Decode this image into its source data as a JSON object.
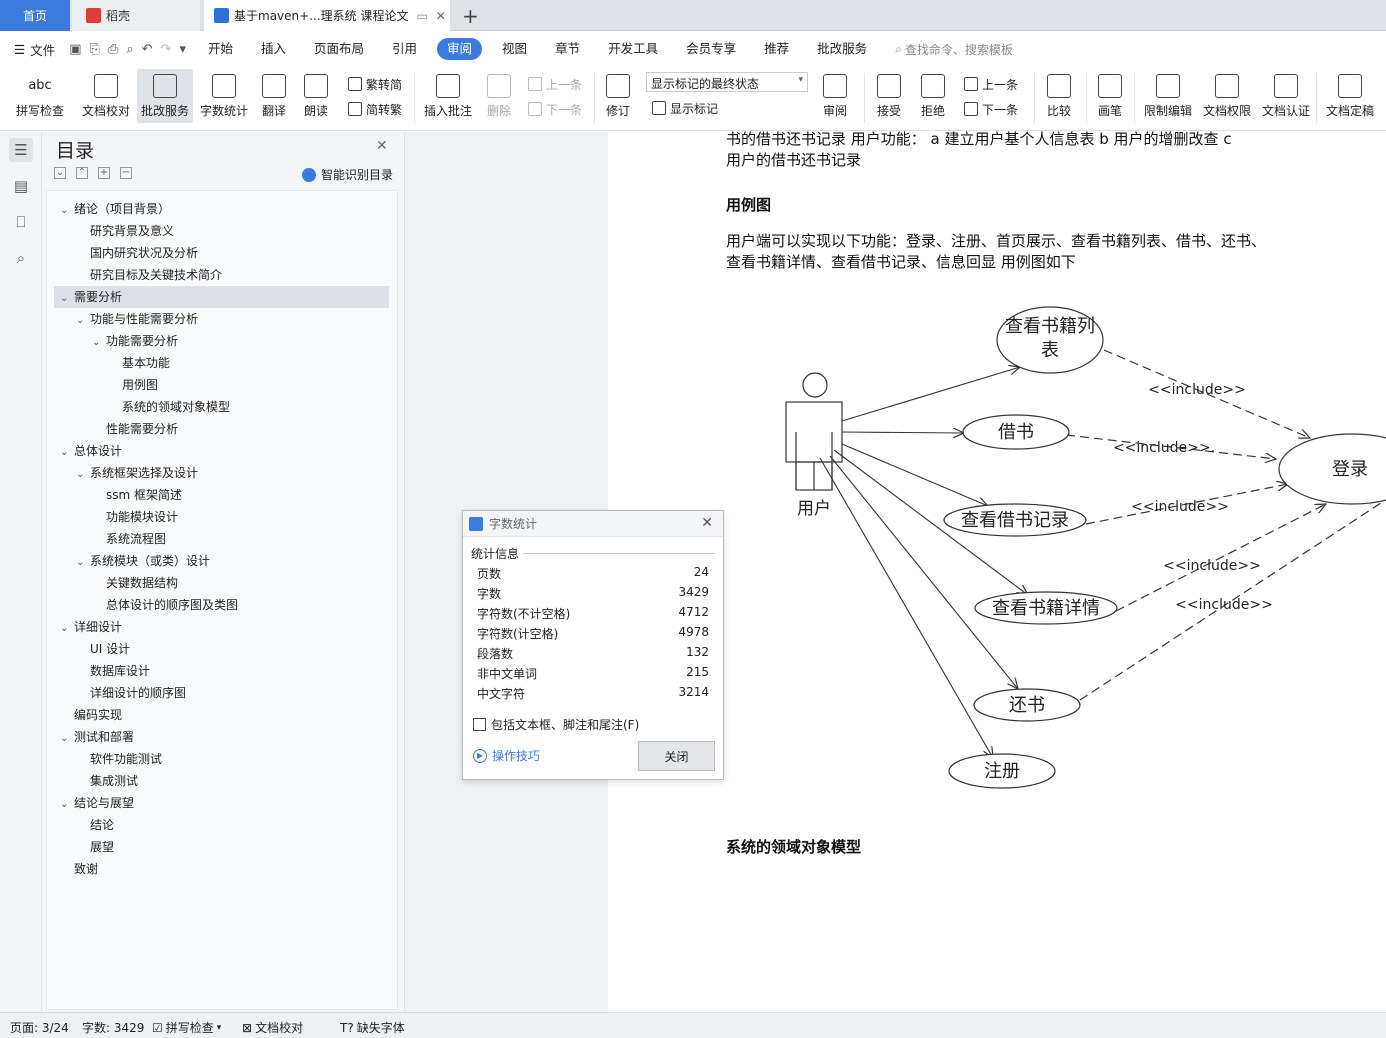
{
  "tabs": {
    "home": "首页",
    "daoke": "稻壳",
    "doc": "基于maven+...理系统 课程论文"
  },
  "menu": {
    "file": "文件",
    "items": [
      "开始",
      "插入",
      "页面布局",
      "引用",
      "审阅",
      "视图",
      "章节",
      "开发工具",
      "会员专享",
      "推荐",
      "批改服务"
    ],
    "active": "审阅",
    "search_placeholder": "查找命令、搜索模板"
  },
  "toolbar": {
    "spell": "拼写检查",
    "proof": "文档校对",
    "review_service": "批改服务",
    "word_count": "字数统计",
    "translate": "翻译",
    "read": "朗读",
    "trad": "繁转简",
    "simp": "简转繁",
    "insert_comment": "插入批注",
    "delete": "删除",
    "prev": "上一条",
    "next": "下一条",
    "revise": "修订",
    "markup_state": "显示标记的最终状态",
    "show_markup": "显示标记",
    "review": "审阅",
    "accept": "接受",
    "reject": "拒绝",
    "prev2": "上一条",
    "next2": "下一条",
    "compare": "比较",
    "pen": "画笔",
    "restrict": "限制编辑",
    "permission": "文档权限",
    "certify": "文档认证",
    "finalize": "文档定稿"
  },
  "toc": {
    "title": "目录",
    "smart": "智能识别目录",
    "items": [
      {
        "label": "绪论（项目背景）",
        "level": 0,
        "arrow": "⌄"
      },
      {
        "label": "研究背景及意义",
        "level": 1,
        "arrow": ""
      },
      {
        "label": "国内研究状况及分析",
        "level": 1,
        "arrow": ""
      },
      {
        "label": "研究目标及关键技术简介",
        "level": 1,
        "arrow": ""
      },
      {
        "label": "需要分析",
        "level": 0,
        "arrow": "⌄"
      },
      {
        "label": "功能与性能需要分析",
        "level": 1,
        "arrow": "⌄"
      },
      {
        "label": "功能需要分析",
        "level": 2,
        "arrow": "⌄"
      },
      {
        "label": "基本功能",
        "level": 3,
        "arrow": ""
      },
      {
        "label": "用例图",
        "level": 3,
        "arrow": ""
      },
      {
        "label": "系统的领域对象模型",
        "level": 3,
        "arrow": ""
      },
      {
        "label": "性能需要分析",
        "level": 2,
        "arrow": ""
      },
      {
        "label": "总体设计",
        "level": 0,
        "arrow": "⌄"
      },
      {
        "label": "系统框架选择及设计",
        "level": 1,
        "arrow": "⌄"
      },
      {
        "label": "ssm 框架简述",
        "level": 2,
        "arrow": ""
      },
      {
        "label": "功能模块设计",
        "level": 2,
        "arrow": ""
      },
      {
        "label": "系统流程图",
        "level": 2,
        "arrow": ""
      },
      {
        "label": "系统模块（或类）设计",
        "level": 1,
        "arrow": "⌄"
      },
      {
        "label": "关键数据结构",
        "level": 2,
        "arrow": ""
      },
      {
        "label": "总体设计的顺序图及类图",
        "level": 2,
        "arrow": ""
      },
      {
        "label": "详细设计",
        "level": 0,
        "arrow": "⌄"
      },
      {
        "label": "UI 设计",
        "level": 1,
        "arrow": ""
      },
      {
        "label": "数据库设计",
        "level": 1,
        "arrow": ""
      },
      {
        "label": "详细设计的顺序图",
        "level": 1,
        "arrow": ""
      },
      {
        "label": "编码实现",
        "level": 0,
        "arrow": ""
      },
      {
        "label": "测试和部署",
        "level": 0,
        "arrow": "⌄"
      },
      {
        "label": "软件功能测试",
        "level": 1,
        "arrow": ""
      },
      {
        "label": "集成测试",
        "level": 1,
        "arrow": ""
      },
      {
        "label": "结论与展望",
        "level": 0,
        "arrow": "⌄"
      },
      {
        "label": "结论",
        "level": 1,
        "arrow": ""
      },
      {
        "label": "展望",
        "level": 1,
        "arrow": ""
      },
      {
        "label": "致谢",
        "level": 0,
        "arrow": ""
      }
    ]
  },
  "doc": {
    "line1": "书的借书还书记录  用户功能：  a  建立用户基个人信息表  b  用户的增删改查  c",
    "line2": "用户的借书还书记录",
    "heading1": "用例图",
    "para1": "用户端可以实现以下功能：登录、注册、首页展示、查看书籍列表、借书、还书、",
    "para2": "查看书籍详情、查看借书记录、信息回显  用例图如下",
    "heading2": "系统的领域对象模型"
  },
  "diagram": {
    "actor": "用户",
    "uc_list_1": "查看书籍列",
    "uc_list_2": "表",
    "uc_borrow": "借书",
    "uc_records": "查看借书记录",
    "uc_detail": "查看书籍详情",
    "uc_return": "还书",
    "uc_register": "注册",
    "uc_login": "登录",
    "include": "<<include>>",
    "include_dot": "<<include>>."
  },
  "dialog": {
    "title": "字数统计",
    "section": "统计信息",
    "stats": [
      {
        "label": "页数",
        "value": "24"
      },
      {
        "label": "字数",
        "value": "3429"
      },
      {
        "label": "字符数(不计空格)",
        "value": "4712"
      },
      {
        "label": "字符数(计空格)",
        "value": "4978"
      },
      {
        "label": "段落数",
        "value": "132"
      },
      {
        "label": "非中文单词",
        "value": "215"
      },
      {
        "label": "中文字符",
        "value": "3214"
      }
    ],
    "checkbox": "包括文本框、脚注和尾注(F)",
    "tips": "操作技巧",
    "close": "关闭"
  },
  "status": {
    "page": "页面: 3/24",
    "words": "字数: 3429",
    "spell": "拼写检查",
    "proof": "文档校对",
    "font": "缺失字体"
  },
  "colors": {
    "accent": "#3b7bde",
    "doc_blue": "#2f6fd8"
  }
}
